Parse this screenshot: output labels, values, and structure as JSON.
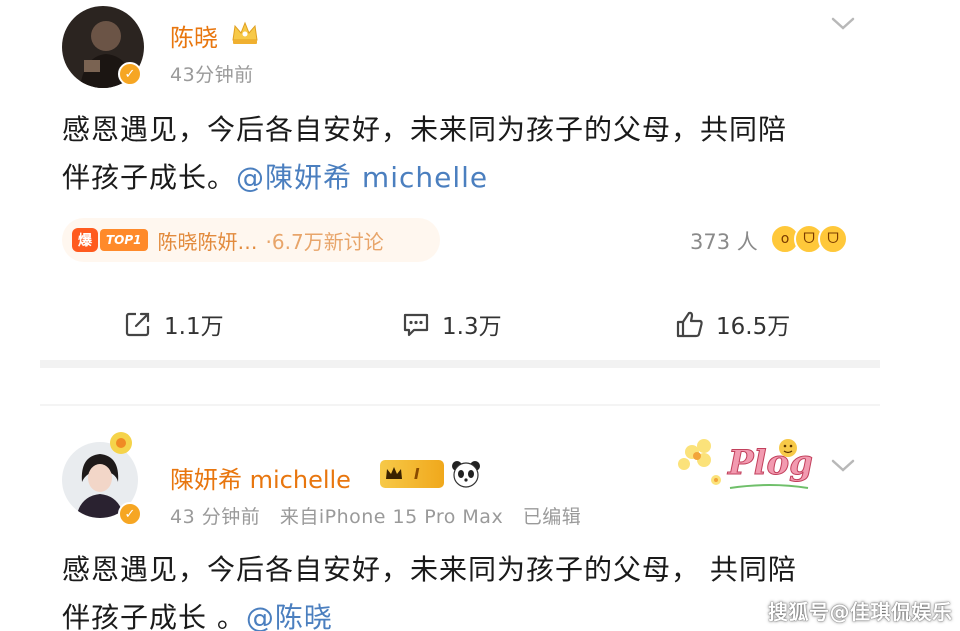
{
  "post1": {
    "username": "陈晓",
    "time": "43分钟前",
    "body_line1": "感恩遇见，今后各自安好，未来同为孩子的父母，共同陪",
    "body_line2": "伴孩子成长。",
    "mention": "@陳妍希 michelle",
    "hot": {
      "badge": "爆",
      "rank": "TOP1",
      "topic": "陈晓陈妍…",
      "discussion": "·6.7万新讨论"
    },
    "reaction_count": "373 人",
    "actions": {
      "repost": "1.1万",
      "comment": "1.3万",
      "like": "16.5万"
    }
  },
  "post2": {
    "username": "陳妍希 michelle",
    "vip_level": "I",
    "meta": "43 分钟前   来自iPhone 15 Pro Max   已编辑",
    "body_line1": "感恩遇见，今后各自安好，未来同为孩子的父母， 共同陪",
    "body_line2": "伴孩子成长 。",
    "mention": "@陈晓",
    "sticker": "Plog"
  },
  "watermark": "搜狐号@佳琪侃娱乐",
  "colors": {
    "username": "#e8760e",
    "mention": "#4b7fbf",
    "verified": "#f6a623",
    "hot": "#ff5b1f"
  }
}
